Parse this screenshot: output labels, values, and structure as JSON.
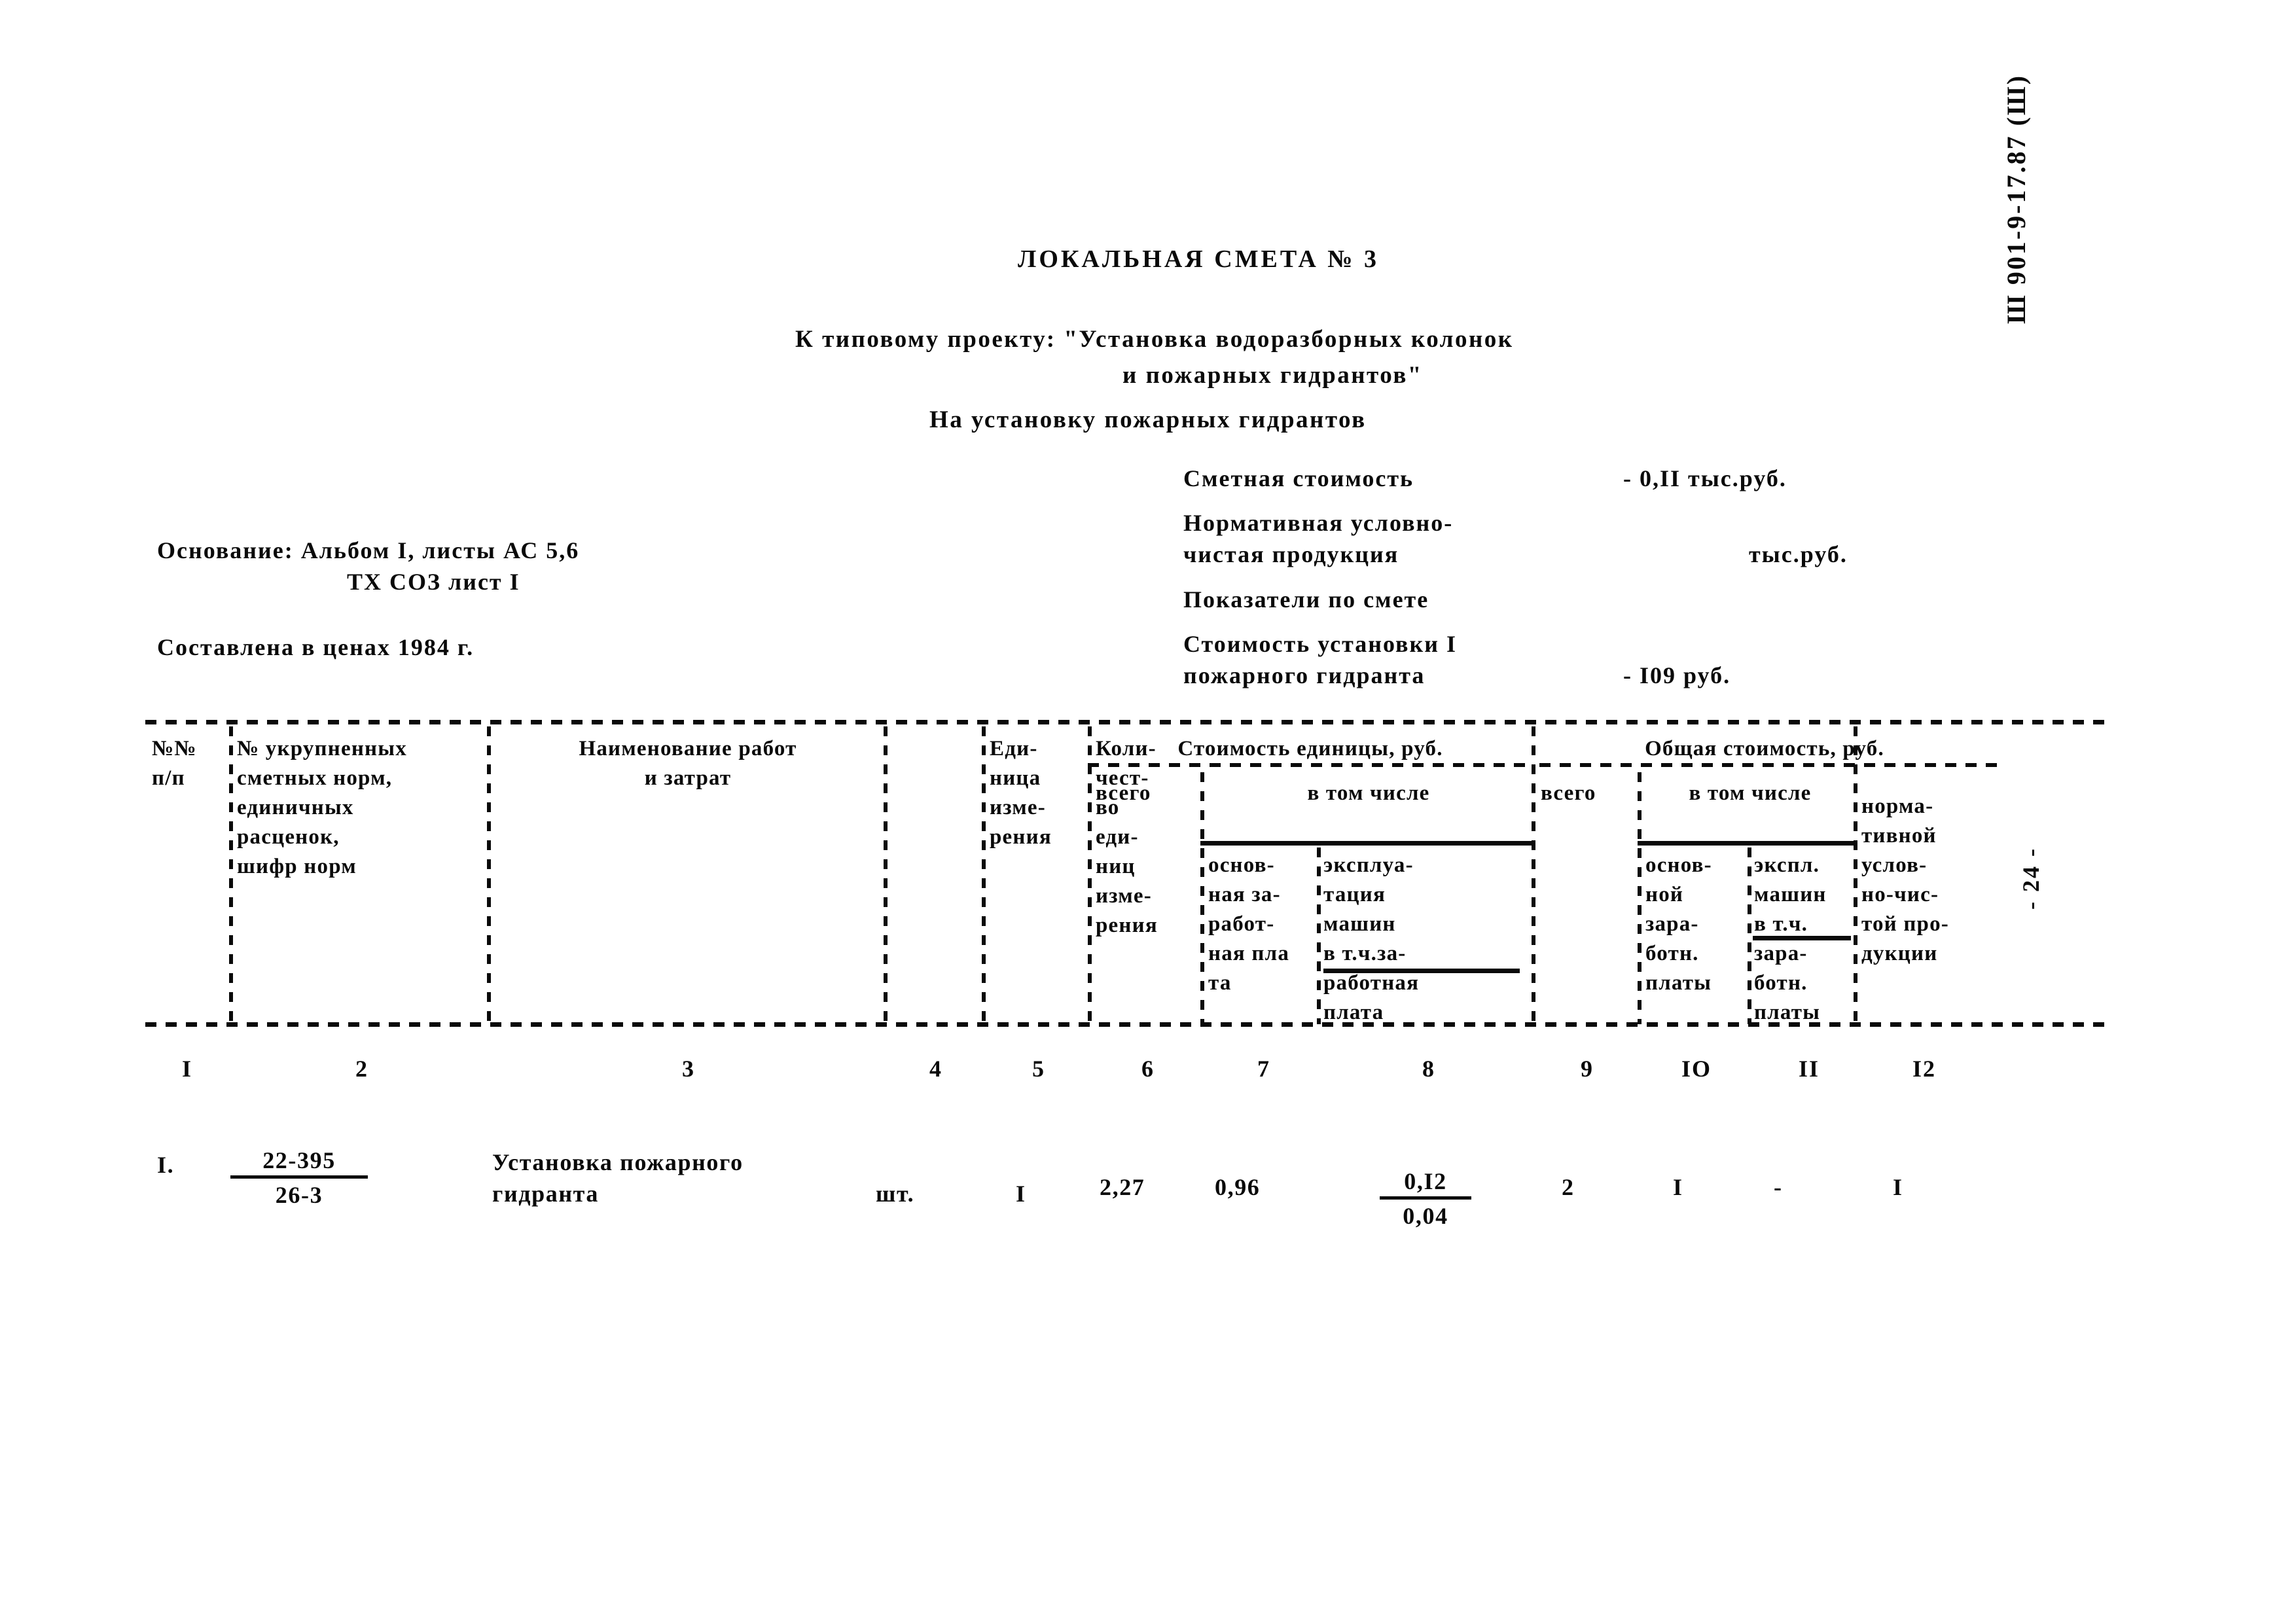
{
  "document": {
    "title": "ЛОКАЛЬНАЯ СМЕТА № 3",
    "subtitle_line1": "К типовому проекту: \"Установка водоразборных колонок",
    "subtitle_line2": "и пожарных гидрантов\"",
    "subtitle_line3": "На установку пожарных гидрантов",
    "side_code": "Ш 901-9-17.87 (Ш)",
    "page_number": "- 24 -"
  },
  "basis": {
    "line1": "Основание: Альбом I, листы АС 5,6",
    "line2": "ТХ СОЗ лист I",
    "prices": "Составлена в ценах 1984 г."
  },
  "summary": {
    "estimate_cost_label": "Сметная стоимость",
    "estimate_cost_value": "- 0,II тыс.руб.",
    "ncp_label_line1": "Нормативная условно-",
    "ncp_label_line2": "чистая продукция",
    "ncp_value": "тыс.руб.",
    "indicators_label": "Показатели по смете",
    "unit_cost_label_line1": "Стоимость установки I",
    "unit_cost_label_line2": "пожарного гидранта",
    "unit_cost_value": "- I09 руб."
  },
  "table": {
    "group_headers": [
      {
        "id": "unit-cost-group",
        "label": "Стоимость единицы, руб."
      },
      {
        "id": "total-cost-group",
        "label": "Общая стоимость, руб."
      }
    ],
    "columns": [
      {
        "num": "I",
        "lines": [
          "№№",
          "п/п"
        ]
      },
      {
        "num": "2",
        "lines": [
          "№ укрупненных",
          "сметных норм,",
          "единичных",
          "расценок,",
          "шифр норм"
        ]
      },
      {
        "num": "3",
        "lines": [
          "Наименование работ",
          "и затрат"
        ]
      },
      {
        "num": "4",
        "lines": [
          "Еди-",
          "ница",
          "изме-",
          "рения"
        ]
      },
      {
        "num": "5",
        "lines": [
          "Коли-",
          "чест-",
          "во",
          "еди-",
          "ниц",
          "изме-",
          "рения"
        ]
      },
      {
        "num": "6",
        "lines": [
          "всего"
        ]
      },
      {
        "num": "7",
        "lines": [
          "в том числе",
          "основ-",
          "ная за-",
          "работ-",
          "ная пла",
          "та"
        ]
      },
      {
        "num": "8",
        "lines": [
          "эксплуа-",
          "тация",
          "машин",
          "в т.ч.за-",
          "работная",
          "плата"
        ]
      },
      {
        "num": "9",
        "lines": [
          "всего"
        ]
      },
      {
        "num": "IO",
        "lines": [
          "в том числе",
          "основ-",
          "ной",
          "зара-",
          "ботн.",
          "платы"
        ]
      },
      {
        "num": "II",
        "lines": [
          "экспл.",
          "машин",
          "в т.ч.",
          "зара-",
          "ботн.",
          "платы"
        ]
      },
      {
        "num": "I2",
        "lines": [
          "норма-",
          "тивной",
          "услов-",
          "но-чис-",
          "той про-",
          "дукции"
        ]
      }
    ],
    "subheader_vtch_left": "в том числе",
    "subheader_vtch_right": "в том числе",
    "subheader_vsego_left": "всего",
    "subheader_vsego_right": "всего",
    "rows": [
      {
        "c1": "I.",
        "c2_num": "22-395",
        "c2_den": "26-3",
        "c3_line1": "Установка пожарного",
        "c3_line2": "гидранта",
        "c4": "шт.",
        "c5": "I",
        "c6": "2,27",
        "c7": "0,96",
        "c8_num": "0,I2",
        "c8_den": "0,04",
        "c9": "2",
        "c10": "I",
        "c11": "-",
        "c12": "I"
      }
    ]
  }
}
